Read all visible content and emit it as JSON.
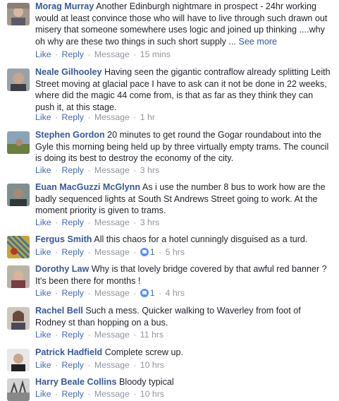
{
  "actions": {
    "like": "Like",
    "reply": "Reply",
    "message": "Message",
    "dot": "·"
  },
  "comments": [
    {
      "author": "Morag Murray",
      "text": "Another Edinburgh nightmare in prospect - 24hr working would at least convince those who will have to live through such drawn out misery that someone somewhere uses logic and joined up thinking ....why oh why are these two things in such short supply ...",
      "see_more": "See more",
      "time": "15 mins"
    },
    {
      "author": "Neale Gilhooley",
      "text": "Having seen the gigantic contraflow already splitting Leith Street moving at glacial pace I have to ask can it not be done in 22 weeks, where did the magic 44 come from, is that as far as they think they can push it, at this stage.",
      "time": "1 hr"
    },
    {
      "author": "Stephen Gordon",
      "text": "20 minutes to get round the Gogar roundabout into the Gyle this morning being held up by three virtually empty trams. The council is doing its best to destroy the economy of the city.",
      "time": "3 hrs"
    },
    {
      "author": "Euan MacGuzzi McGlynn",
      "text": "As i use the number 8 bus to work how are the badly sequenced lights at South St Andrews Street going to work. At the moment priority is given to trams.",
      "time": "3 hrs"
    },
    {
      "author": "Fergus Smith",
      "text": "All this chaos for a hotel cunningly disguised as a turd.",
      "likes": "1",
      "time": "5 hrs"
    },
    {
      "author": "Dorothy Law",
      "text": "Why is that lovely bridge covered by that awful red banner ? It's been there for months !",
      "likes": "1",
      "time": "4 hrs"
    },
    {
      "author": "Rachel Bell",
      "text": "Such a mess. Quicker walking to Waverley from foot of Rodney st than hopping on a bus.",
      "time": "11 hrs"
    },
    {
      "author": "Patrick Hadfield",
      "text": "Complete screw up.",
      "time": "10 hrs"
    },
    {
      "author": "Harry Beale Collins",
      "text": "Bloody typical",
      "time": "10 hrs"
    }
  ]
}
